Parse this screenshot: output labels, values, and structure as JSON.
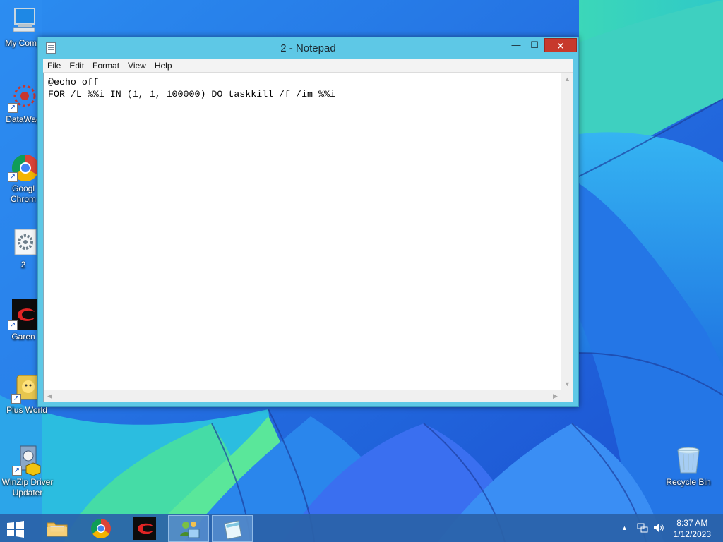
{
  "desktop": {
    "icons": [
      {
        "label": "My Comp",
        "icon": "computer-icon"
      },
      {
        "label": "DataWag",
        "icon": "datawag-icon"
      },
      {
        "label_line1": "Googl",
        "label_line2": "Chrom",
        "icon": "chrome-icon"
      },
      {
        "label": "2",
        "icon": "gear-document-icon"
      },
      {
        "label": "Garen",
        "icon": "garena-icon"
      },
      {
        "label": "Plus World",
        "icon": "plus-world-icon"
      },
      {
        "label_line1": "WinZip Driver",
        "label_line2": "Updater",
        "icon": "winzip-driver-icon"
      },
      {
        "label": "Recycle Bin",
        "icon": "recycle-bin-icon"
      }
    ]
  },
  "notepad": {
    "title": "2 - Notepad",
    "close_symbol": "✕",
    "maximize_symbol": "☐",
    "minimize_symbol": "—",
    "menu": [
      "File",
      "Edit",
      "Format",
      "View",
      "Help"
    ],
    "content": "@echo off\nFOR /L %%i IN (1, 1, 100000) DO taskkill /f /im %%i"
  },
  "taskbar": {
    "apps": [
      {
        "name": "file-explorer",
        "icon": "folder-icon"
      },
      {
        "name": "google-chrome",
        "icon": "chrome-icon"
      },
      {
        "name": "garena",
        "icon": "garena-icon"
      },
      {
        "name": "network-app",
        "icon": "network-people-icon"
      },
      {
        "name": "notepad",
        "icon": "notepad-icon",
        "active": true
      }
    ],
    "tray": {
      "chevron": "▲",
      "time": "8:37 AM",
      "date": "1/12/2023"
    }
  },
  "colors": {
    "window_frame": "#5ec8e6",
    "close_button": "#c7392c",
    "taskbar": "#2a62a8"
  }
}
